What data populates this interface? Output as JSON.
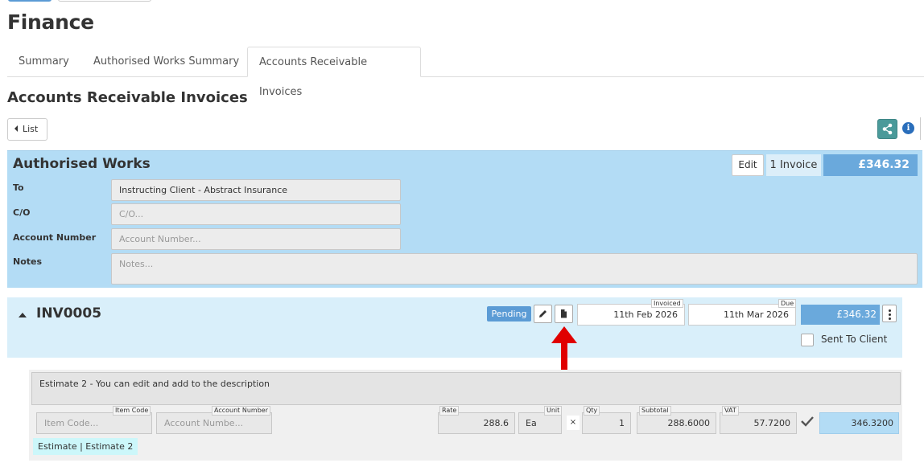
{
  "page": {
    "title": "Finance"
  },
  "tabs": [
    {
      "label": "Summary",
      "active": false
    },
    {
      "label": "Authorised Works Summary",
      "active": false
    },
    {
      "label": "Accounts Receivable Invoices",
      "active": true
    }
  ],
  "section": {
    "title": "Accounts Receivable Invoices"
  },
  "toolbar": {
    "list_label": "List",
    "share_icon": "share-icon",
    "info_icon": "info-icon"
  },
  "authorised_works": {
    "title": "Authorised Works",
    "edit_label": "Edit",
    "invoice_count": "1 Invoice",
    "total": "£346.32",
    "fields": {
      "to": {
        "label": "To",
        "value": "Instructing Client - Abstract Insurance"
      },
      "co": {
        "label": "C/O",
        "placeholder": "C/O..."
      },
      "account_number": {
        "label": "Account Number",
        "placeholder": "Account Number..."
      },
      "notes": {
        "label": "Notes",
        "placeholder": "Notes..."
      }
    }
  },
  "invoice": {
    "number": "INV0005",
    "status": "Pending",
    "invoiced_label": "Invoiced",
    "invoiced_date": "11th Feb 2026",
    "due_label": "Due",
    "due_date": "11th Mar 2026",
    "total": "£346.32",
    "sent_to_client_label": "Sent To Client",
    "sent_to_client": false
  },
  "line_item": {
    "description": "Estimate 2 - You can edit and add to the description",
    "item_code_label": "Item Code",
    "item_code_placeholder": "Item Code...",
    "account_number_label": "Account Number",
    "account_number_placeholder": "Account Numbe...",
    "rate_label": "Rate",
    "rate": "288.6",
    "unit_label": "Unit",
    "unit": "Ea",
    "multiply": "×",
    "qty_label": "Qty",
    "qty": "1",
    "subtotal_label": "Subtotal",
    "subtotal": "288.6000",
    "vat_label": "VAT",
    "vat": "57.7200",
    "vat_checked": true,
    "total": "346.3200",
    "tag": "Estimate | Estimate 2"
  },
  "colors": {
    "panel_blue": "#b3dcf5",
    "invoice_panel": "#d9effa",
    "total_blue": "#6aa9dc",
    "pending": "#5b9bd5",
    "share_teal": "#4a9a9a",
    "arrow_red": "#e00000"
  }
}
